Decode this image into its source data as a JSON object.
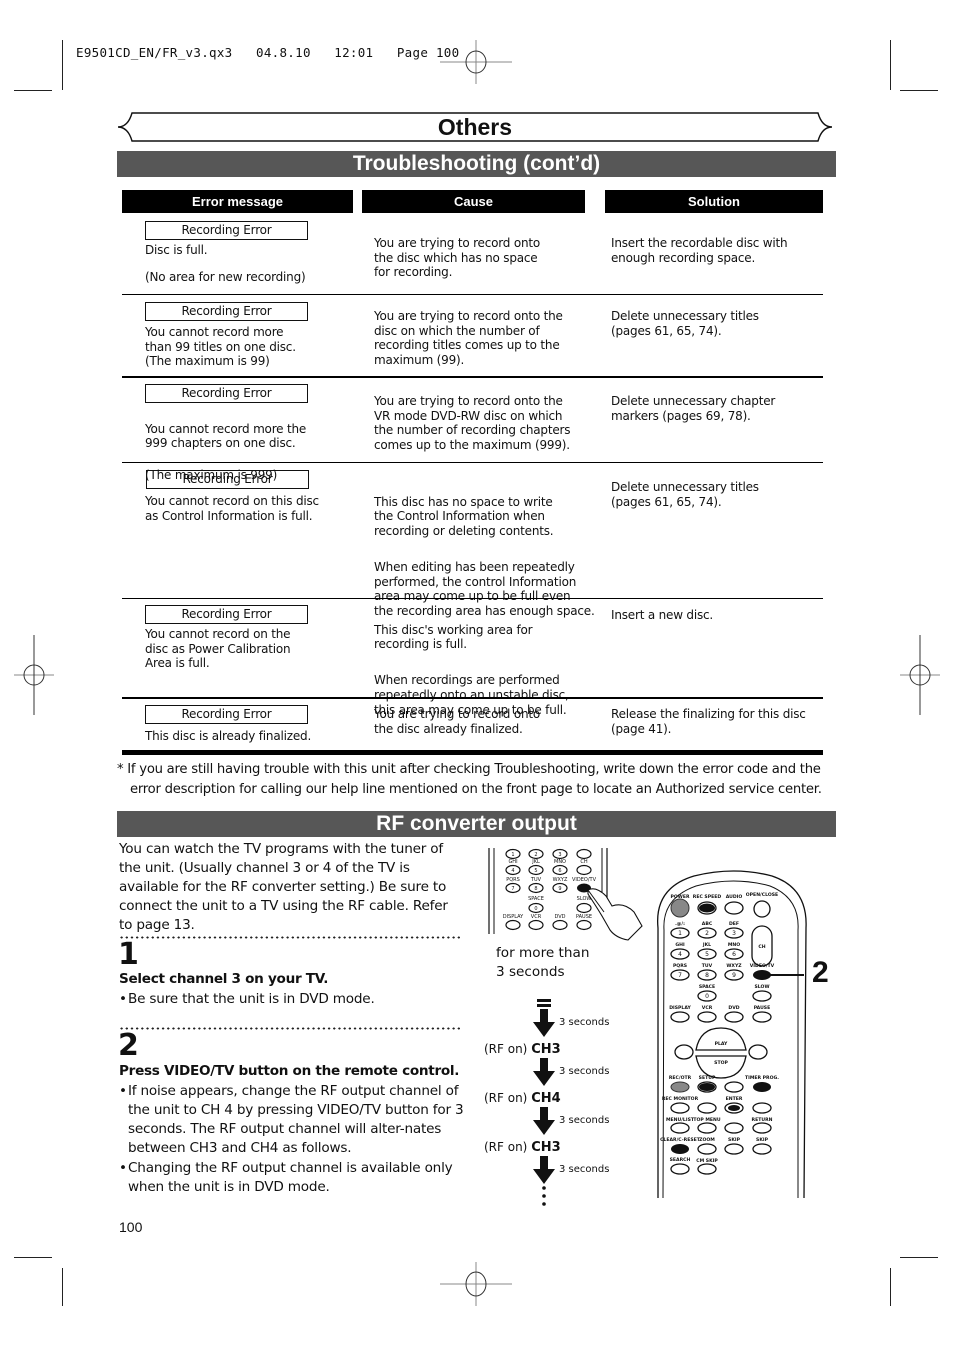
{
  "slug": {
    "text": "E9501CD_EN/FR_v3.qx3   04.8.10   12:01   Page 100"
  },
  "header": {
    "chapter_title": "Others",
    "section_title": "Troubleshooting (cont’d)"
  },
  "table": {
    "columns": [
      "Error message",
      "Cause",
      "Solution"
    ],
    "rows": [
      {
        "error_label": "Recording Error",
        "error_desc": [
          "Disc is full.",
          "(No area for new recording)"
        ],
        "cause": [
          "You are trying to record onto\nthe disc which has no space\nfor recording."
        ],
        "solution": "Insert the recordable disc with\nenough recording space."
      },
      {
        "error_label": "Recording Error",
        "error_desc": [
          "You cannot record more\nthan 99 titles on one disc.\n(The maximum is 99)"
        ],
        "cause": [
          "You are trying to record onto the\ndisc on which the number of\nrecording titles comes up to the\nmaximum (99)."
        ],
        "solution": "Delete unnecessary titles\n(pages 61, 65, 74)."
      },
      {
        "error_label": "Recording Error",
        "error_desc": [
          "You cannot record more the\n999 chapters on one disc.",
          "(The maximum is 999)"
        ],
        "cause": [
          "You are trying to record onto the\nVR mode DVD-RW disc on which\nthe number of recording chapters\ncomes up to the maximum (999)."
        ],
        "solution": "Delete unnecessary chapter\nmarkers (pages 69, 78)."
      },
      {
        "error_label": "Recording Error",
        "error_desc": [
          "You cannot record on this disc\nas Control Information is full."
        ],
        "cause": [
          "This disc has no space to write\nthe Control Information when\nrecording or deleting contents.",
          "When editing has been repeatedly\nperformed, the control Information\narea may come up to be full even\nthe recording area has enough space."
        ],
        "solution": "Delete unnecessary titles\n(pages 61, 65, 74)."
      },
      {
        "error_label": "Recording Error",
        "error_desc": [
          "You cannot record on the\ndisc as Power Calibration\nArea is full."
        ],
        "cause": [
          "This disc's working area for\nrecording is full.",
          "When recordings are performed\nrepeatedly onto an unstable disc,\nthis area may come up to be full."
        ],
        "solution": "Insert a new disc."
      },
      {
        "error_label": "Recording Error",
        "error_desc": [
          "This disc is already finalized."
        ],
        "cause": [
          "You are trying to record onto\nthe disc already finalized."
        ],
        "solution": "Release the finalizing for this disc\n(page 41)."
      }
    ]
  },
  "footnote": {
    "line1": "* If you are still having trouble with this unit after checking Troubleshooting, write down the error code and the",
    "line2": "error description for calling our help line mentioned on the front page to locate an Authorized service center."
  },
  "rf_section": {
    "title": "RF converter output",
    "intro": "You can watch the TV programs with the tuner of the unit. (Usually channel 3 or 4 of the TV is available for the RF converter setting.) Be sure to connect the unit to a TV using the RF cable. Refer to page 13.",
    "steps": [
      {
        "number": "1",
        "title": "Select channel 3 on your TV.",
        "bullets": [
          "Be sure that the unit is in DVD mode."
        ]
      },
      {
        "number": "2",
        "title": "Press VIDEO/TV button on the remote control.",
        "bullets": [
          "If noise appears, change the RF output channel of the unit to CH 4 by pressing VIDEO/TV button for 3 seconds. The RF output channel will alter-nates between CH3 and CH4 as follows.",
          "Changing the RF output channel is available only when the unit is in DVD mode."
        ]
      }
    ],
    "hold_caption": "for more than\n3 seconds",
    "flow": {
      "arrow_label": "3 seconds",
      "states": [
        {
          "prefix": "(RF on)",
          "channel": "CH3"
        },
        {
          "prefix": "(RF on)",
          "channel": "CH4"
        },
        {
          "prefix": "(RF on)",
          "channel": "CH3"
        }
      ]
    },
    "callout_number": "2"
  },
  "remote": {
    "top_labels": [
      "POWER",
      "REC SPEED",
      "AUDIO",
      "OPEN/CLOSE"
    ],
    "keypad": [
      {
        "letters": ".@/:",
        "digit": "1"
      },
      {
        "letters": "ABC",
        "digit": "2"
      },
      {
        "letters": "DEF",
        "digit": "3"
      },
      {
        "letters": "GHI",
        "digit": "4"
      },
      {
        "letters": "JKL",
        "digit": "5"
      },
      {
        "letters": "MNO",
        "digit": "6"
      },
      {
        "letters": "PQRS",
        "digit": "7"
      },
      {
        "letters": "TUV",
        "digit": "8"
      },
      {
        "letters": "WXYZ",
        "digit": "9"
      },
      {
        "letters": "SPACE",
        "digit": "0"
      }
    ],
    "ch_label": "CH",
    "videotv_label": "VIDEO/TV",
    "slow_label": "SLOW",
    "row_labels": [
      "DISPLAY",
      "VCR",
      "DVD",
      "PAUSE"
    ],
    "play_label": "PLAY",
    "stop_label": "STOP",
    "lower_labels": [
      "REC/OTR",
      "SETUP",
      "TIMER PROG.",
      "REC MONITOR",
      "ENTER",
      "MENU/LIST",
      "TOP MENU",
      "RETURN",
      "CLEAR/C-RESET",
      "ZOOM",
      "SKIP",
      "SKIP",
      "SEARCH MODE",
      "CM SKIP"
    ]
  },
  "page_number": "100"
}
